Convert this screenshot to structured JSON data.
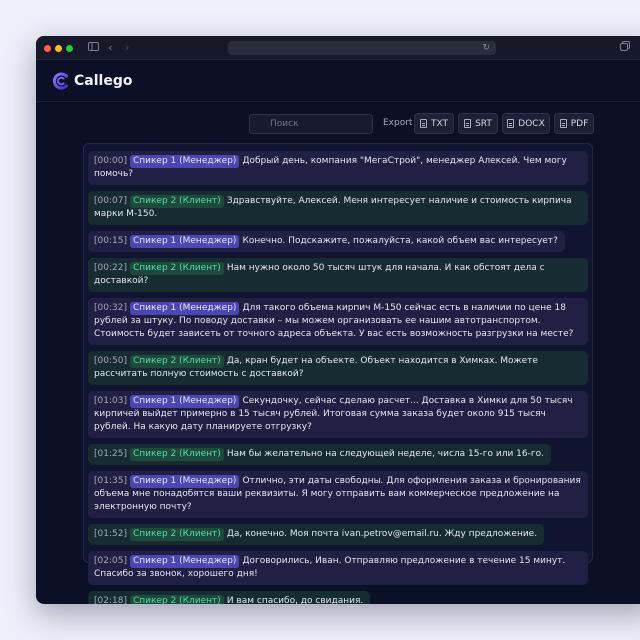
{
  "app": {
    "name": "Callego",
    "accent": "#5b52e0"
  },
  "toolbar": {
    "search_placeholder": "Поиск",
    "export_label": "Export",
    "export_buttons": [
      "TXT",
      "SRT",
      "DOCX",
      "PDF"
    ]
  },
  "speakers": {
    "manager": {
      "label": "Спикер 1 (Менеджер)",
      "color": "#4c46b3"
    },
    "client": {
      "label": "Спикер 2 (Клиент)",
      "color": "#4fe1a2"
    }
  },
  "messages": [
    {
      "time": "[00:00]",
      "text": "Добрый день, компания \"МегаСтрой\", менеджер Алексей. Чем могу помочь?"
    },
    {
      "time": "[00:07]",
      "text": "Здравствуйте, Алексей. Меня интересует наличие и стоимость кирпича марки М-150."
    },
    {
      "time": "[00:15]",
      "text": "Конечно. Подскажите, пожалуйста, какой объем вас интересует?"
    },
    {
      "time": "[00:22]",
      "text": "Нам нужно около 50 тысяч штук для начала. И как обстоят дела с доставкой?"
    },
    {
      "time": "[00:32]",
      "text": "Для такого объема кирпич М-150 сейчас есть в наличии по цене 18 рублей за штуку. По поводу доставки – мы можем организовать ее нашим автотранспортом. Стоимость будет зависеть от точного адреса объекта. У вас есть возможность разгрузки на месте?"
    },
    {
      "time": "[00:50]",
      "text": "Да, кран будет на объекте. Объект находится в Химках. Можете рассчитать полную стоимость с доставкой?"
    },
    {
      "time": "[01:03]",
      "text": "Секундочку, сейчас сделаю расчет... Доставка в Химки для 50 тысяч кирпичей выйдет примерно в 15 тысяч рублей. Итоговая сумма заказа будет около 915 тысяч рублей. На какую дату планируете отгрузку?"
    },
    {
      "time": "[01:25]",
      "text": "Нам бы желательно на следующей неделе, числа 15-го или 16-го."
    },
    {
      "time": "[01:35]",
      "text": "Отлично, эти даты свободны. Для оформления заказа и бронирования объема мне понадобятся ваши реквизиты. Я могу отправить вам коммерческое предложение на электронную почту?"
    },
    {
      "time": "[01:52]",
      "text": "Да, конечно. Моя почта ivan.petrov@email.ru. Жду предложение."
    },
    {
      "time": "[02:05]",
      "text": "Договорились, Иван. Отправляю предложение в течение 15 минут. Спасибо за звонок, хорошего дня!"
    },
    {
      "time": "[02:18]",
      "text": "И вам спасибо, до свидания."
    }
  ]
}
